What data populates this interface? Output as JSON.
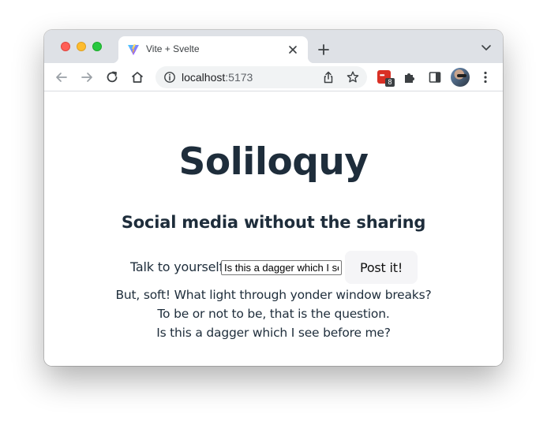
{
  "browser": {
    "tab": {
      "title": "Vite + Svelte",
      "favicon": "vite-logo-icon"
    },
    "url": {
      "host": "localhost",
      "port": ":5173"
    },
    "extension_badge": "8",
    "icons": [
      "back-arrow-icon",
      "forward-arrow-icon",
      "reload-icon",
      "home-icon",
      "info-icon",
      "share-icon",
      "star-icon",
      "extension-icon",
      "puzzle-icon",
      "side-panel-icon",
      "avatar",
      "more-menu-icon"
    ]
  },
  "app": {
    "title": "Soliloquy",
    "subtitle": "Social media without the sharing",
    "compose": {
      "label": "Talk to yourself:",
      "input_value": "Is this a dagger which I see before me?",
      "button_label": "Post it!"
    },
    "posts": [
      "But, soft! What light through yonder window breaks?",
      "To be or not to be, that is the question.",
      "Is this a dagger which I see before me?"
    ]
  },
  "colors": {
    "text": "#1e2d3b",
    "titlebar": "#dee1e6",
    "omnibox": "#f1f3f4",
    "button_bg": "#f5f5f7",
    "close_light": "#ff5f57",
    "minimize_light": "#febc2e",
    "maximize_light": "#28c840"
  }
}
